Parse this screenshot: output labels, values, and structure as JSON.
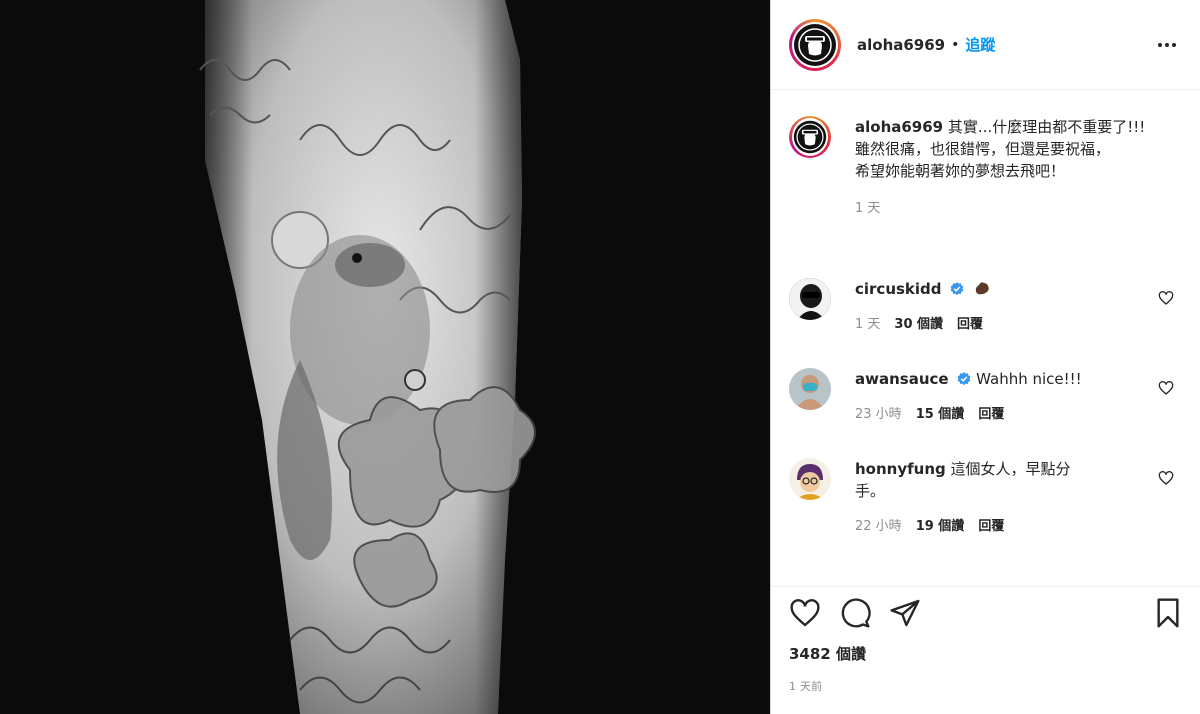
{
  "post": {
    "username": "aloha6969",
    "follow_label": "追蹤",
    "separator": "•"
  },
  "caption": {
    "username": "aloha6969",
    "text": "其實...什麼理由都不重要了!!!",
    "line2": "雖然很痛，也很錯愕，但還是要祝福，",
    "line3": "希望妳能朝著妳的夢想去飛吧！",
    "time": "1 天"
  },
  "comments": [
    {
      "username": "circuskidd",
      "verified": true,
      "text": "",
      "time": "1 天",
      "likes": "30 個讚",
      "reply": "回覆"
    },
    {
      "username": "awansauce",
      "verified": true,
      "text": "Wahhh nice!!!",
      "time": "23 小時",
      "likes": "15 個讚",
      "reply": "回覆"
    },
    {
      "username": "honnyfung",
      "verified": false,
      "text": "這個女人，早點分手。",
      "time": "22 小時",
      "likes": "19 個讚",
      "reply": "回覆"
    }
  ],
  "footer": {
    "likes_count": "3482 個讚",
    "posted": "1 天前"
  },
  "icons": {
    "like": "heart-icon",
    "comment": "comment-icon",
    "share": "paper-plane-icon",
    "save": "bookmark-icon",
    "more": "more-horizontal-icon",
    "verified": "verified-badge-icon"
  },
  "colors": {
    "accent": "#0095f6",
    "verified": "#3897f0",
    "muted": "#8e8e8e"
  }
}
